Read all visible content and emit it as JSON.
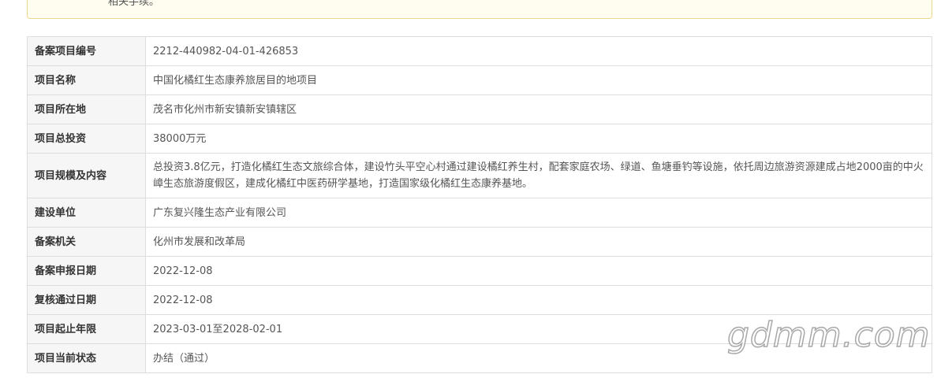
{
  "notice": {
    "text": "相关手续。"
  },
  "rows": [
    {
      "label": "备案项目编号",
      "value": "2212-440982-04-01-426853"
    },
    {
      "label": "项目名称",
      "value": "中国化橘红生态康养旅居目的地项目"
    },
    {
      "label": "项目所在地",
      "value": "茂名市化州市新安镇新安镇辖区"
    },
    {
      "label": "项目总投资",
      "value": "38000万元"
    },
    {
      "label": "项目规模及内容",
      "value": "总投资3.8亿元，打造化橘红生态文旅综合体，建设竹头平空心村通过建设橘红养生村，配套家庭农场、绿道、鱼塘垂钓等设施，依托周边旅游资源建成占地2000亩的中火嶂生态旅游度假区，建成化橘红中医药研学基地，打造国家级化橘红生态康养基地。"
    },
    {
      "label": "建设单位",
      "value": "广东复兴隆生态产业有限公司"
    },
    {
      "label": "备案机关",
      "value": "化州市发展和改革局"
    },
    {
      "label": "备案申报日期",
      "value": "2022-12-08"
    },
    {
      "label": "复核通过日期",
      "value": "2022-12-08"
    },
    {
      "label": "项目起止年限",
      "value": "2023-03-01至2028-02-01"
    },
    {
      "label": "项目当前状态",
      "value": "办结（通过）"
    }
  ],
  "watermark": {
    "text": "gdmm.com"
  }
}
